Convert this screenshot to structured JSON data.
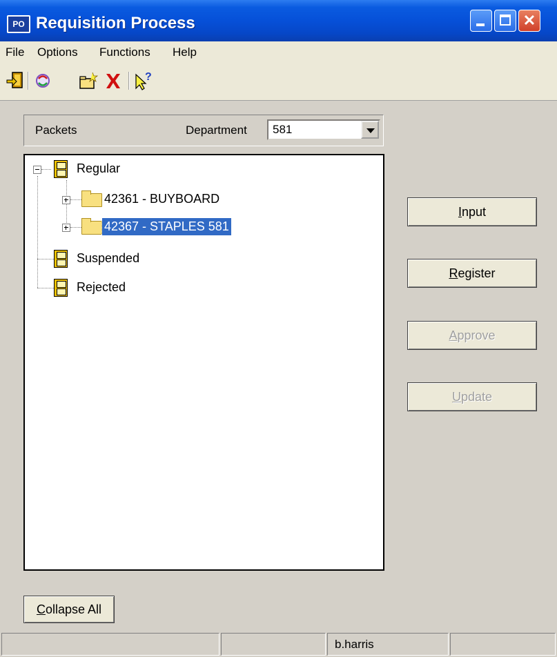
{
  "window": {
    "title": "Requisition Process",
    "app_icon_text": "PO"
  },
  "menu": {
    "items": [
      "File",
      "Options",
      "Functions",
      "Help"
    ]
  },
  "toolbar": {
    "icons": [
      "exit-icon",
      "refresh-icon",
      "open-folder-icon",
      "delete-icon",
      "help-icon"
    ]
  },
  "packets": {
    "label": "Packets",
    "department_label": "Department",
    "department_value": "581"
  },
  "tree": {
    "nodes": [
      {
        "label": "Regular",
        "expanded": true
      },
      {
        "label": "42361 - BUYBOARD",
        "expanded": false
      },
      {
        "label": "42367 - STAPLES 581",
        "expanded": false,
        "selected": true
      },
      {
        "label": "Suspended"
      },
      {
        "label": "Rejected"
      }
    ]
  },
  "buttons": {
    "input": {
      "mnemonic": "I",
      "rest": "nput",
      "enabled": true
    },
    "register": {
      "mnemonic": "R",
      "rest": "egister",
      "enabled": true
    },
    "approve": {
      "mnemonic": "A",
      "rest": "pprove",
      "enabled": false
    },
    "update": {
      "mnemonic": "U",
      "rest": "pdate",
      "enabled": false
    },
    "collapse_all": {
      "mnemonic": "C",
      "rest": "ollapse All"
    }
  },
  "status": {
    "panes": [
      "",
      "",
      "b.harris",
      ""
    ]
  },
  "colors": {
    "selection": "#316ac5",
    "titlebar": "#0650d8",
    "face": "#d4d0c8"
  }
}
